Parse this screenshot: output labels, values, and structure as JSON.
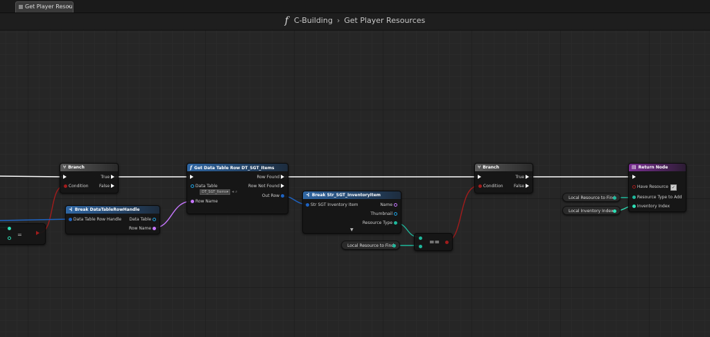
{
  "tab": {
    "label": "Get Player Resourc",
    "close": "×"
  },
  "header": {
    "function_icon": "f",
    "breadcrumb_parent": "C-Building",
    "separator": "›",
    "breadcrumb_current": "Get Player Resources"
  },
  "nodes": {
    "branch1": {
      "title": "Branch",
      "true_label": "True",
      "false_label": "False",
      "condition_label": "Condition"
    },
    "break_handle": {
      "title": "Break DataTableRowHandle",
      "in_label": "Data Table Row Handle",
      "out_table": "Data Table",
      "out_row": "Row Name"
    },
    "get_row": {
      "title": "Get Data Table Row DT_SGT_Items",
      "table_label": "Data Table",
      "table_value": "DT_SGT_Items",
      "row_name": "Row Name",
      "row_found": "Row Found",
      "row_not_found": "Row Not Found",
      "out_row": "Out Row"
    },
    "break_struct": {
      "title": "Break Str_SGT_InventoryItem",
      "in_label": "Str SGT Inventory Item",
      "out_name": "Name",
      "out_thumb": "Thumbnail",
      "out_type": "Resource Type",
      "expand": "▼"
    },
    "equal": {
      "label": "=="
    },
    "branch2": {
      "title": "Branch",
      "true_label": "True",
      "false_label": "False",
      "condition_label": "Condition"
    },
    "return": {
      "title": "Return Node",
      "have_label": "Have Resource",
      "type_label": "Resource Type to Add",
      "index_label": "Inventory Index",
      "check": "✓"
    },
    "left_partial": {
      "label": "="
    }
  },
  "vars": {
    "local_find_1": "Local Resource to Find",
    "local_find_2": "Local Resource to Find",
    "local_index": "Local Inventory Index"
  },
  "colors": {
    "exec": "#ffffff",
    "bool": "#a11c1c",
    "name": "#c777ff",
    "struct": "#1e63c2",
    "enum": "#1fb89c",
    "int": "#2ee0b6",
    "object": "#1ea5e6"
  }
}
